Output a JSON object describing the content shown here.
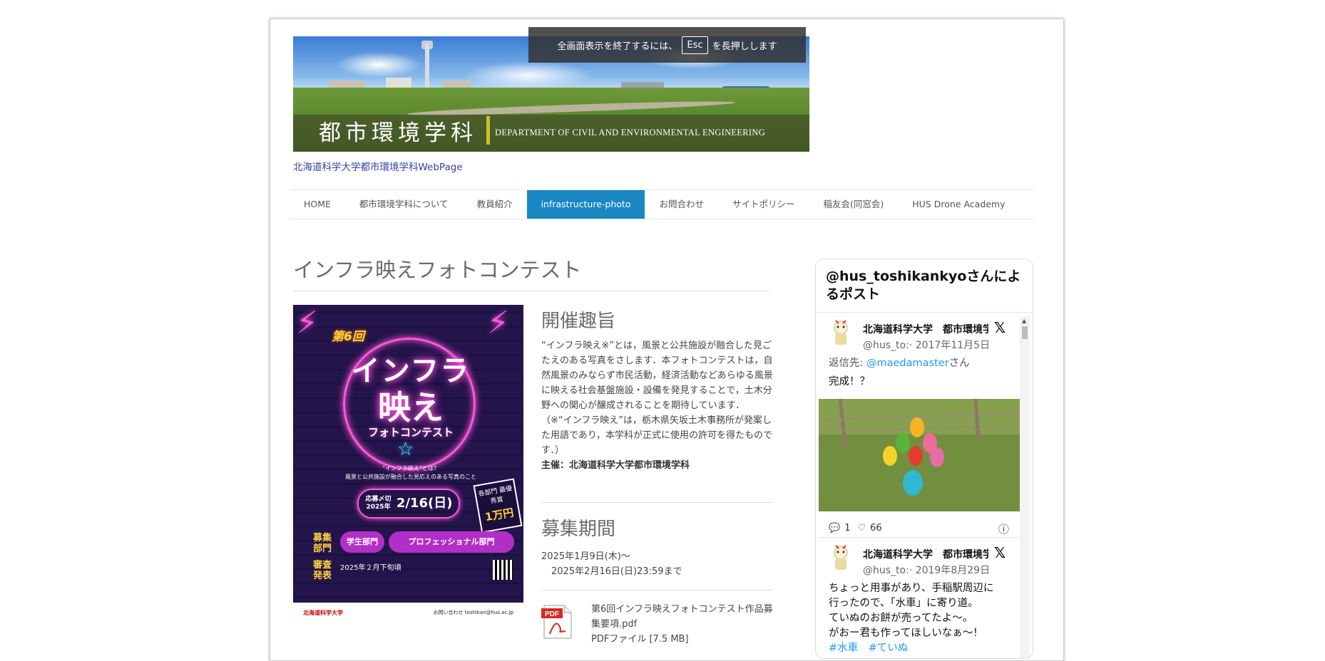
{
  "browser": {
    "fullscreen_notice_prefix": "全画面表示を終了するには、",
    "fullscreen_notice_key": "Esc",
    "fullscreen_notice_suffix": "を長押しします"
  },
  "header": {
    "banner_title_jp": "都市環境学科",
    "banner_title_en": "DEPARTMENT OF CIVIL AND ENVIRONMENTAL ENGINEERING",
    "site_link": "北海道科学大学都市環境学科WebPage"
  },
  "nav": {
    "items": [
      {
        "label": "HOME",
        "active": false
      },
      {
        "label": "都市環境学科について",
        "active": false
      },
      {
        "label": "教員紹介",
        "active": false
      },
      {
        "label": "infrastructure-photo",
        "active": true
      },
      {
        "label": "お問合わせ",
        "active": false
      },
      {
        "label": "サイトポリシー",
        "active": false
      },
      {
        "label": "稲友会(同窓会)",
        "active": false
      },
      {
        "label": "HUS Drone Academy",
        "active": false
      }
    ],
    "active_color": "#1b87c2"
  },
  "main": {
    "page_title": "インフラ映えフォトコンテスト",
    "poster": {
      "edition": "第6回",
      "title_line1": "インフラ",
      "title_line2": "映え",
      "title_line3": "フォトコンテスト",
      "description_1": "“インフラ映え”とは？",
      "description_2": "風景と公共施設が融合した見応えのある写真のこと",
      "deadline_label": "応募〆切 2025年",
      "deadline_date": "2/16(日)",
      "prize_top": "各部門 最優秀賞",
      "prize_amount": "1万円",
      "category_label": "募集 部門",
      "category_student": "学生部門",
      "category_pro": "プロフェッショナル部門",
      "judging_label": "審査 発表",
      "judging_text": "2025年２月下旬頃",
      "footer_left": "北海道科学大学",
      "footer_right": "お問い合わせ toshikan@hus.ac.jp"
    },
    "section1": {
      "heading": "開催趣旨",
      "text": "“インフラ映え※”とは，風景と公共施設が融合した見ごたえのある写真をさします．本フォトコンテストは，自然風景のみならず市民活動，経済活動などあらゆる風景に映える社会基盤施設・設備を発見することで，土木分野への関心が醸成されることを期待しています．",
      "note": "（※“インフラ映え”は，栃木県矢坂土木事務所が発案した用語であり，本学科が正式に使用の許可を得たものです．）",
      "organizer": "主催：北海道科学大学都市環境学科"
    },
    "section2": {
      "heading": "募集期間",
      "line1": "2025年1月9日(木)～",
      "line2": "2025年2月16日(日)23:59まで"
    },
    "file": {
      "icon_label": "PDF",
      "name": "第6回インフラ映えフォトコンテスト作品募集要項.pdf",
      "meta": "PDFファイル [7.5 MB]"
    }
  },
  "widget": {
    "title": "@hus_toshikankyoさんによるポスト",
    "tweets": [
      {
        "name": "北海道科学大学　都市環境学科",
        "handle": "@hus_to:",
        "date": "· 2017年11月5日",
        "reply_prefix": "返信先: ",
        "reply_to": "@maedamaster",
        "reply_suffix": "さん",
        "text": "完成！？",
        "replies": "1",
        "likes": "66"
      },
      {
        "name": "北海道科学大学　都市環境学科",
        "handle": "@hus_to:",
        "date": "· 2019年8月29日",
        "line1": "ちょっと用事があり、手稲駅周辺に",
        "line2": "行ったので、「水車」に寄り道。",
        "line3": "ていぬのお餅が売ってたよ～。",
        "line4": "がおー君も作ってほしいなぁ～！",
        "hashtags": "#水車　#ていぬ"
      }
    ]
  }
}
